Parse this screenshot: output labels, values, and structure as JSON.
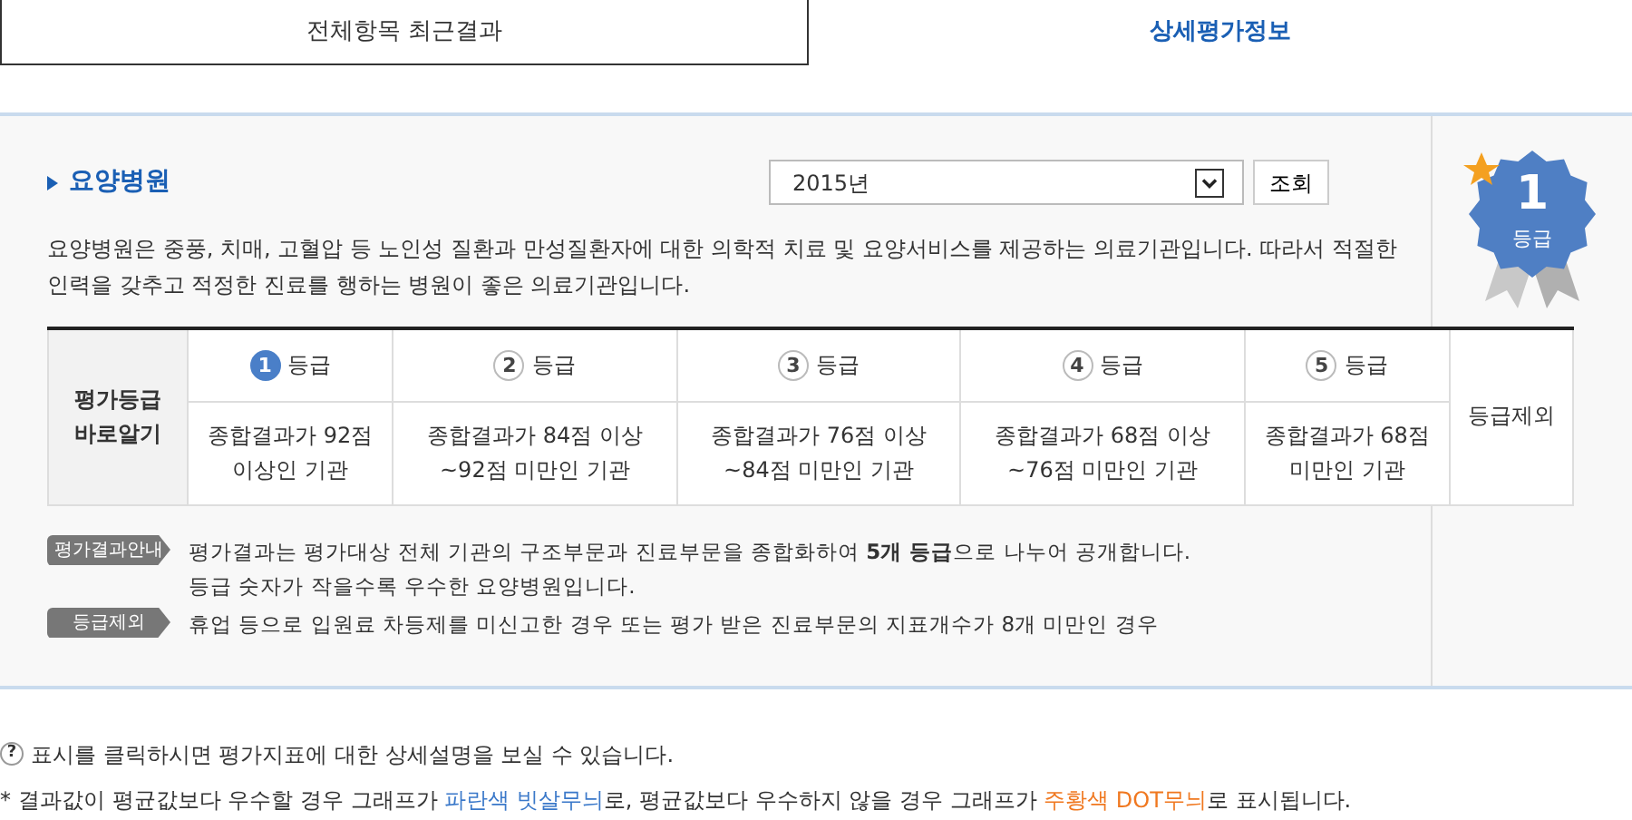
{
  "tabs": [
    {
      "label": "전체항목 최근결과",
      "selected": false
    },
    {
      "label": "상세평가정보",
      "selected": true
    }
  ],
  "section": {
    "title": "요양병원",
    "year_select": {
      "value": "2015년"
    },
    "search_button": "조회",
    "description": "요양병원은 중풍, 치매, 고혈압 등 노인성 질환과 만성질환자에 대한 의학적 치료 및 요양서비스를 제공하는 의료기관입니다. 따라서 적절한 인력을 갖추고 적정한 진료를 행하는 병원이 좋은 의료기관입니다."
  },
  "badge": {
    "grade": "1",
    "label": "등급"
  },
  "grade_table": {
    "row_header": "평가등급 바로알기",
    "grades": [
      {
        "number": "1",
        "label": "등급",
        "selected": true,
        "criteria": "종합결과가 92점 이상인 기관"
      },
      {
        "number": "2",
        "label": "등급",
        "selected": false,
        "criteria": "종합결과가 84점 이상 ~92점 미만인 기관"
      },
      {
        "number": "3",
        "label": "등급",
        "selected": false,
        "criteria": "종합결과가 76점 이상 ~84점 미만인 기관"
      },
      {
        "number": "4",
        "label": "등급",
        "selected": false,
        "criteria": "종합결과가 68점 이상 ~76점 미만인 기관"
      },
      {
        "number": "5",
        "label": "등급",
        "selected": false,
        "criteria": "종합결과가 68점 미만인 기관"
      }
    ],
    "excluded": "등급제외"
  },
  "notes": [
    {
      "tag": "평가결과안내",
      "lines": [
        "평가결과는 평가대상 전체 기관의 구조부문과 진료부문을 종합화하여 **5개 등급**으로 나누어 공개합니다.",
        "등급 숫자가 작을수록 우수한 요양병원입니다."
      ]
    },
    {
      "tag": "등급제외",
      "lines": [
        "휴업 등으로 입원료 차등제를 미신고한 경우 또는 평가 받은 진료부문의 지표개수가 8개 미만인 경우"
      ]
    }
  ],
  "footer": [
    {
      "marker": "?",
      "segments": [
        {
          "kind": "plain",
          "text": "표시를 클릭하시면 평가지표에 대한 상세설명을 보실 수 있습니다."
        }
      ]
    },
    {
      "marker": "*",
      "segments": [
        {
          "kind": "plain",
          "text": "결과값이 평균값보다 우수할 경우 그래프가"
        },
        {
          "kind": "blue",
          "text": "파란색 빗살무늬"
        },
        {
          "kind": "plain",
          "text": "로, 평균값보다 우수하지 않을 경우 그래프가"
        },
        {
          "kind": "orange",
          "text": "주황색 DOT무늬"
        },
        {
          "kind": "plain",
          "text": "로 표시됩니다."
        }
      ]
    }
  ]
}
